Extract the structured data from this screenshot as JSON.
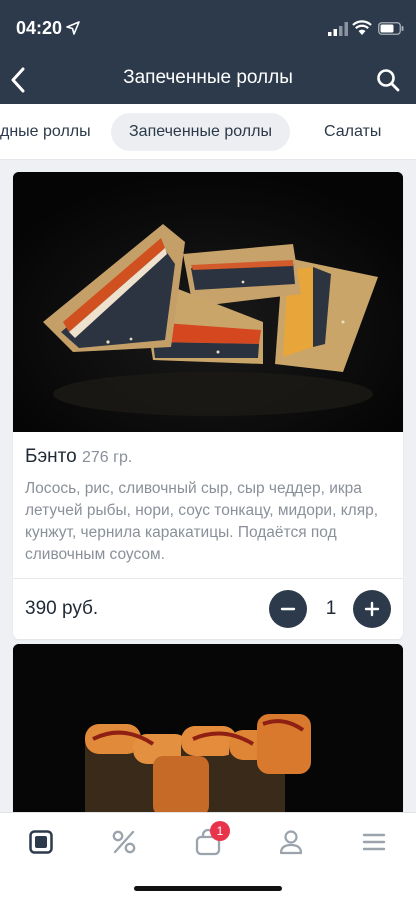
{
  "status_bar": {
    "time": "04:20"
  },
  "header": {
    "title": "Запеченные роллы"
  },
  "categories": [
    {
      "label": "дные роллы"
    },
    {
      "label": "Запеченные роллы"
    },
    {
      "label": "Салаты"
    }
  ],
  "products": [
    {
      "name": "Бэнто",
      "weight": "276 гр.",
      "description": "Лосось, рис, сливочный сыр, сыр чеддер, икра летучей рыбы, нори, соус тонкацу, мидори, кляр, кунжут, чернила каракатицы. Подаётся под сливочным соусом.",
      "price": "390 руб.",
      "quantity": "1"
    }
  ],
  "tabbar": {
    "cart_badge": "1"
  },
  "colors": {
    "header_bg": "#2c3a4b",
    "accent": "#2c3a4b",
    "badge": "#e8344a"
  }
}
